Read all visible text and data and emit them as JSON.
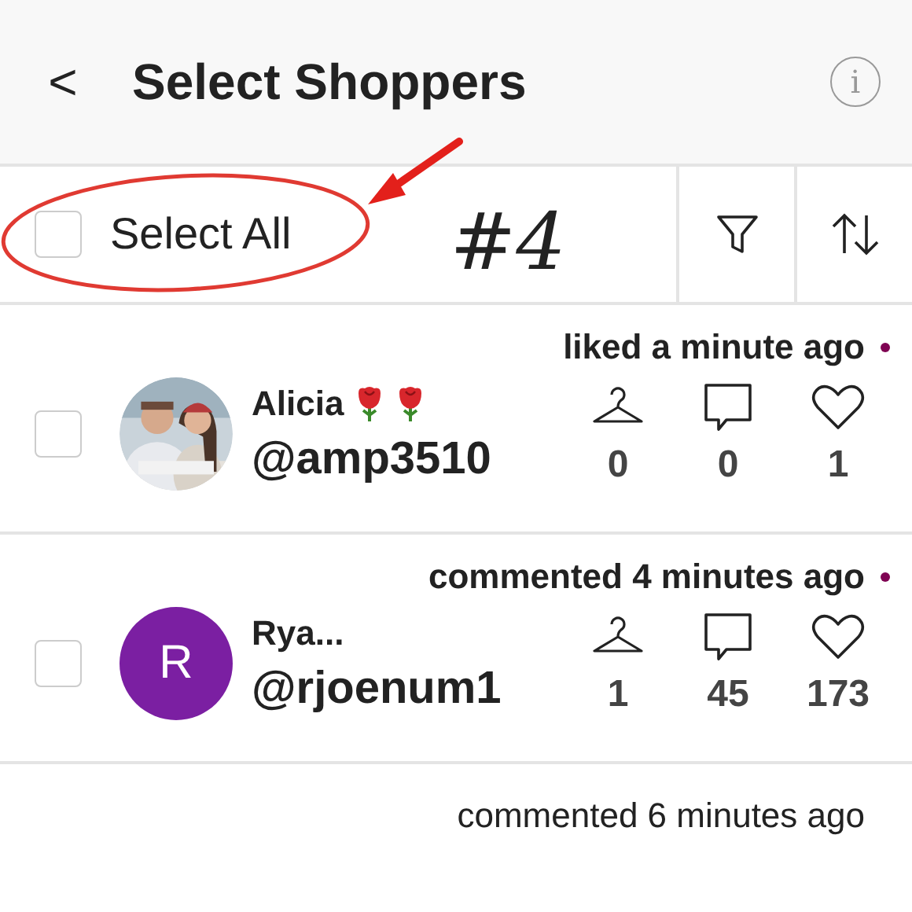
{
  "header": {
    "back": "<",
    "title": "Select Shoppers",
    "info": "i"
  },
  "toolbar": {
    "select_all": {
      "label": "Select All",
      "checked": false
    }
  },
  "annotation": {
    "label": "#4"
  },
  "shoppers": [
    {
      "activity": "liked a minute ago",
      "unread": true,
      "checked": false,
      "avatar": {
        "kind": "picture"
      },
      "name": "Alicia",
      "badges": [
        {
          "kind": "rose"
        },
        {
          "kind": "rose"
        }
      ],
      "handle": "@amp3510",
      "listings": "0",
      "comments": "0",
      "likes": "1"
    },
    {
      "activity": "commented 4 minutes ago",
      "unread": true,
      "checked": false,
      "avatar": {
        "kind": "initial",
        "letter": "R",
        "color": "#7b1fa2"
      },
      "name": "Rya...",
      "handle": "@rjoenum1",
      "listings": "1",
      "comments": "45",
      "likes": "173"
    },
    {
      "activity": "commented 6 minutes ago",
      "unread": false
    }
  ]
}
